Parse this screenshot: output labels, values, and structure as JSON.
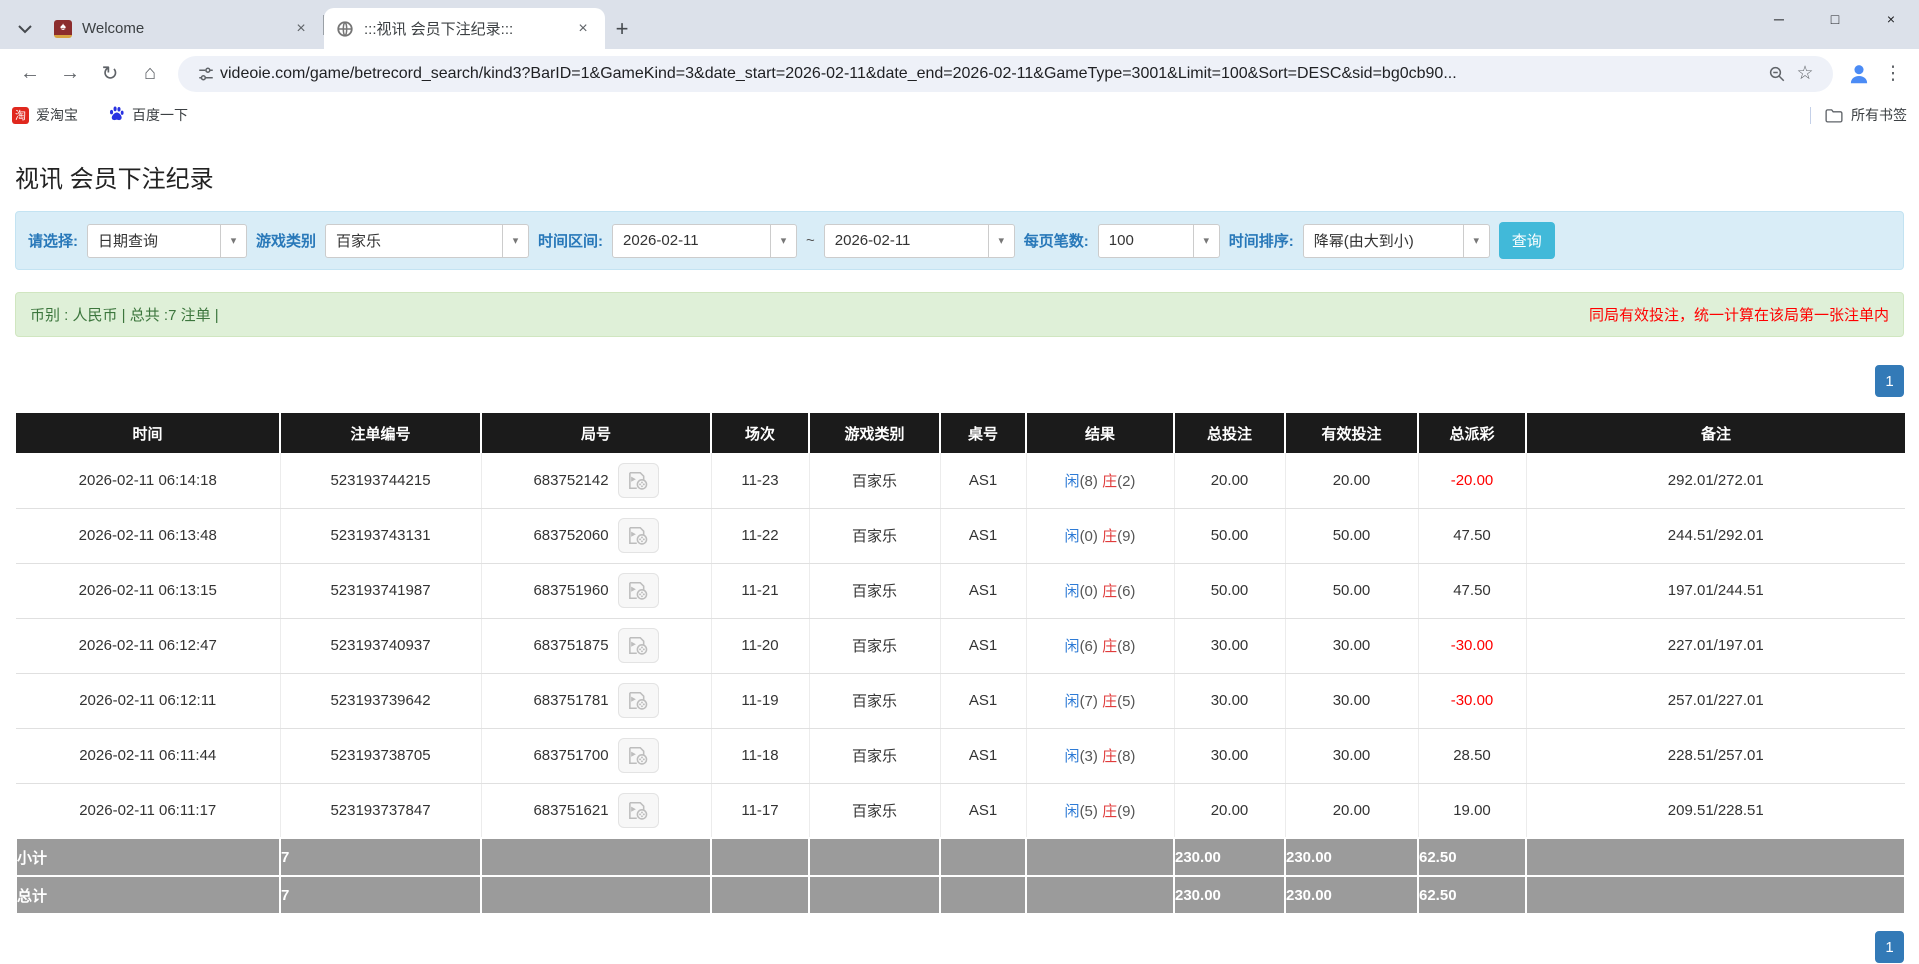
{
  "colors": {
    "accent_blue": "#337ab7",
    "bet_blue": "#2e7bd6",
    "loss_red": "#ff0000",
    "button_cyan": "#41b9d9",
    "filter_label_blue": "#2878b9"
  },
  "browser": {
    "tabs": [
      {
        "title": "Welcome"
      },
      {
        "title": ":::视讯 会员下注纪录:::"
      }
    ],
    "tab_close_glyph": "×",
    "new_tab_glyph": "+",
    "window_controls": {
      "minimize": "─",
      "maximize": "□",
      "close": "×"
    },
    "toolbar": {
      "back_glyph": "←",
      "forward_glyph": "→",
      "reload_glyph": "↻",
      "home_glyph": "⌂",
      "url": "videoie.com/game/betrecord_search/kind3?BarID=1&GameKind=3&date_start=2026-02-11&date_end=2026-02-11&GameType=3001&Limit=100&Sort=DESC&sid=bg0cb90...",
      "star_glyph": "☆",
      "menu_glyph": "⋮"
    },
    "bookmarks": {
      "taobao_label": "爱淘宝",
      "taobao_icon_text": "淘",
      "baidu_label": "百度一下",
      "all_bookmarks_label": "所有书签"
    }
  },
  "page": {
    "title": "视讯 会员下注纪录",
    "filters": {
      "select_label": "请选择:",
      "select_value": "日期查询",
      "game_kind_label": "游戏类别",
      "game_kind_value": "百家乐",
      "date_range_label": "时间区间:",
      "date_start": "2026-02-11",
      "tilde": "~",
      "date_end": "2026-02-11",
      "per_page_label": "每页笔数:",
      "per_page_value": "100",
      "sort_label": "时间排序:",
      "sort_value": "降幂(由大到小)",
      "search_button": "查询",
      "arrow_glyph": "▾"
    },
    "summary": {
      "left": "币别 : 人民币 | 总共 :7 注单 |",
      "right": "同局有效投注，统一计算在该局第一张注单内"
    },
    "pagination_label": "1",
    "table": {
      "headers": [
        "时间",
        "注单编号",
        "局号",
        "场次",
        "游戏类别",
        "桌号",
        "结果",
        "总投注",
        "有效投注",
        "总派彩",
        "备注"
      ],
      "result_player_label": "闲",
      "result_banker_label": "庄",
      "rows": [
        {
          "time": "2026-02-11 06:14:18",
          "bet_id": "523193744215",
          "round_id": "683752142",
          "session": "11-23",
          "game": "百家乐",
          "table_no": "AS1",
          "player_score": "(8)",
          "banker_score": "(2)",
          "total_bet": "20.00",
          "valid_bet": "20.00",
          "payout": "-20.00",
          "remark": "292.01/272.01"
        },
        {
          "time": "2026-02-11 06:13:48",
          "bet_id": "523193743131",
          "round_id": "683752060",
          "session": "11-22",
          "game": "百家乐",
          "table_no": "AS1",
          "player_score": "(0)",
          "banker_score": "(9)",
          "total_bet": "50.00",
          "valid_bet": "50.00",
          "payout": "47.50",
          "remark": "244.51/292.01"
        },
        {
          "time": "2026-02-11 06:13:15",
          "bet_id": "523193741987",
          "round_id": "683751960",
          "session": "11-21",
          "game": "百家乐",
          "table_no": "AS1",
          "player_score": "(0)",
          "banker_score": "(6)",
          "total_bet": "50.00",
          "valid_bet": "50.00",
          "payout": "47.50",
          "remark": "197.01/244.51"
        },
        {
          "time": "2026-02-11 06:12:47",
          "bet_id": "523193740937",
          "round_id": "683751875",
          "session": "11-20",
          "game": "百家乐",
          "table_no": "AS1",
          "player_score": "(6)",
          "banker_score": "(8)",
          "total_bet": "30.00",
          "valid_bet": "30.00",
          "payout": "-30.00",
          "remark": "227.01/197.01"
        },
        {
          "time": "2026-02-11 06:12:11",
          "bet_id": "523193739642",
          "round_id": "683751781",
          "session": "11-19",
          "game": "百家乐",
          "table_no": "AS1",
          "player_score": "(7)",
          "banker_score": "(5)",
          "total_bet": "30.00",
          "valid_bet": "30.00",
          "payout": "-30.00",
          "remark": "257.01/227.01"
        },
        {
          "time": "2026-02-11 06:11:44",
          "bet_id": "523193738705",
          "round_id": "683751700",
          "session": "11-18",
          "game": "百家乐",
          "table_no": "AS1",
          "player_score": "(3)",
          "banker_score": "(8)",
          "total_bet": "30.00",
          "valid_bet": "30.00",
          "payout": "28.50",
          "remark": "228.51/257.01"
        },
        {
          "time": "2026-02-11 06:11:17",
          "bet_id": "523193737847",
          "round_id": "683751621",
          "session": "11-17",
          "game": "百家乐",
          "table_no": "AS1",
          "player_score": "(5)",
          "banker_score": "(9)",
          "total_bet": "20.00",
          "valid_bet": "20.00",
          "payout": "19.00",
          "remark": "209.51/228.51"
        }
      ],
      "subtotal": {
        "label": "小计",
        "count": "7",
        "total_bet": "230.00",
        "valid_bet": "230.00",
        "payout": "62.50"
      },
      "total": {
        "label": "总计",
        "count": "7",
        "total_bet": "230.00",
        "valid_bet": "230.00",
        "payout": "62.50"
      }
    }
  }
}
